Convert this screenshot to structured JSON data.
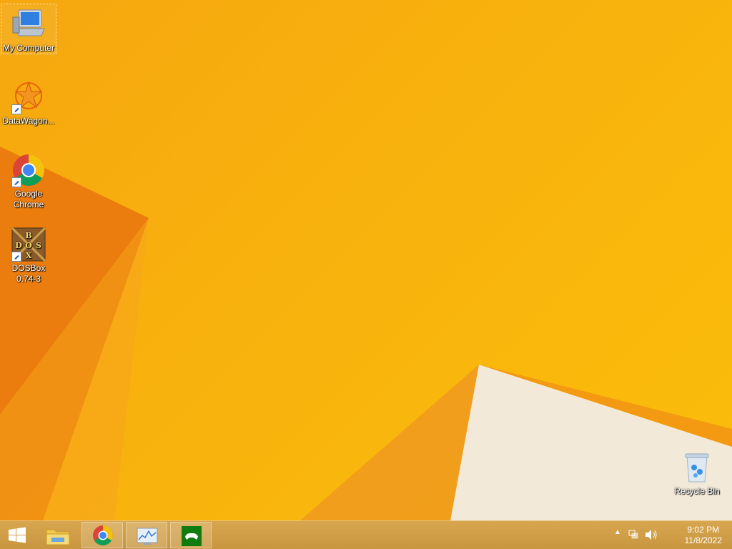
{
  "desktop": {
    "icons": [
      {
        "label": "My Computer"
      },
      {
        "label": "DataWagon..."
      },
      {
        "label": "Google Chrome"
      },
      {
        "label": "DOSBox 0.74-3"
      },
      {
        "label": "Recycle Bin"
      }
    ]
  },
  "taskbar": {
    "items": [
      "start",
      "file-explorer",
      "chrome",
      "resource-monitor",
      "xbox-app"
    ],
    "clock": {
      "time": "9:02 PM",
      "date": "11/8/2022"
    }
  },
  "colors": {
    "wallpaper": "#f8b20d",
    "taskbar": "#cf9d46",
    "accent_dark": "#e8780a"
  }
}
